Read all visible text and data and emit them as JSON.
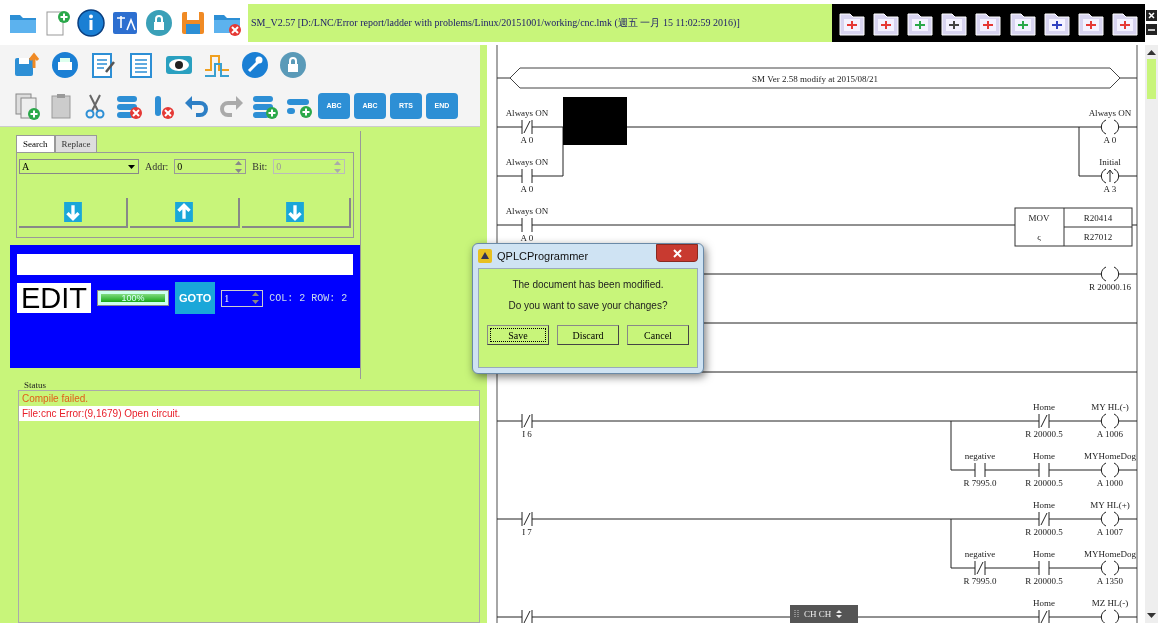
{
  "title": "SM_V2.57 [D:/LNC/Error report/ladder with problems/Linux/20151001/working/cnc.lmk (週五 一月 15 11:02:59 2016)]",
  "insert_buttons": [
    {
      "label": "ABC"
    },
    {
      "label": "ABC"
    },
    {
      "label": "RTS"
    },
    {
      "label": "END"
    }
  ],
  "search": {
    "tabs": [
      {
        "label": "Search",
        "selected": true
      },
      {
        "label": "Replace",
        "selected": false
      }
    ],
    "device": "A",
    "addr_label": "Addr:",
    "addr": "0",
    "bit_label": "Bit:",
    "bit": "0",
    "bit_disabled": true
  },
  "edit_panel": {
    "mode": "EDIT",
    "progress": {
      "level": 1,
      "text": "100%"
    },
    "goto": "GOTO",
    "spin": "1",
    "position": "COL: 2 ROW: 2"
  },
  "status": {
    "label": "Status",
    "messages": [
      {
        "text": "Compile failed.",
        "color": "#e0601a",
        "selected": false
      },
      {
        "text": "File:cnc Error:(9,1679) Open circuit.",
        "color": "#e8202a",
        "selected": true
      }
    ]
  },
  "ladder": {
    "rows": [
      {
        "kind": "comment",
        "text": "SM Ver 2.58 modify at 2015/08/21"
      },
      {
        "kind": "rung",
        "left": [
          {
            "kind": "nc",
            "name": "Always ON",
            "address": "A 0"
          },
          {
            "kind": "redacted"
          }
        ],
        "right": [
          {
            "kind": "coil",
            "name": "Always ON",
            "address": "A 0"
          }
        ],
        "branches": [
          {
            "kind": "left_branch",
            "elements": [
              {
                "kind": "no",
                "name": "Always ON",
                "address": "A 0"
              }
            ]
          },
          {
            "kind": "right_branch",
            "elements": [
              {
                "kind": "pulse_coil",
                "name": "Initial",
                "address": "A 3"
              }
            ]
          }
        ]
      },
      {
        "kind": "rung",
        "left": [
          {
            "kind": "no",
            "name": "Always ON",
            "address": "A 0"
          }
        ],
        "right": [
          {
            "kind": "mov",
            "op": "MOV",
            "symbol": "ς",
            "source": "R20414",
            "dest": "R27012"
          }
        ]
      },
      {
        "kind": "rung",
        "right": [
          {
            "kind": "coil",
            "address": "R 20000.16"
          }
        ]
      },
      {
        "kind": "rung"
      },
      {
        "kind": "rung"
      },
      {
        "kind": "rung",
        "left": [
          {
            "kind": "nc",
            "address": "I 6"
          }
        ],
        "right": [
          {
            "kind": "nc",
            "name": "Home",
            "address": "R 20000.5"
          },
          {
            "kind": "coil",
            "name": "MY HL(-)",
            "address": "A 1006"
          }
        ],
        "branches": [
          {
            "kind": "right_branch",
            "elements": [
              {
                "kind": "no",
                "name": "negative",
                "address": "R 7995.0"
              },
              {
                "kind": "no",
                "name": "Home",
                "address": "R 20000.5"
              },
              {
                "kind": "coil",
                "name": "MYHomeDog",
                "address": "A 1000"
              }
            ]
          }
        ]
      },
      {
        "kind": "rung",
        "left": [
          {
            "kind": "nc",
            "address": "I 7"
          }
        ],
        "right": [
          {
            "kind": "nc",
            "name": "Home",
            "address": "R 20000.5"
          },
          {
            "kind": "coil",
            "name": "MY HL(+)",
            "address": "A 1007"
          }
        ],
        "branches": [
          {
            "kind": "right_branch",
            "elements": [
              {
                "kind": "nc",
                "name": "negative",
                "address": "R 7995.0"
              },
              {
                "kind": "no",
                "name": "Home",
                "address": "R 20000.5"
              },
              {
                "kind": "coil",
                "name": "MYHomeDog",
                "address": "A 1350"
              }
            ]
          }
        ]
      },
      {
        "kind": "rung",
        "left": [
          {
            "kind": "nc"
          }
        ],
        "right": [
          {
            "kind": "nc",
            "name": "Home"
          },
          {
            "kind": "coil",
            "name": "MZ HL(-)"
          }
        ]
      }
    ]
  },
  "dialog": {
    "title": "QPLCProgrammer",
    "lines": [
      "The document has been modified.",
      "Do you want to save your changes?"
    ],
    "buttons": [
      {
        "label": "Save",
        "focused": true
      },
      {
        "label": "Discard",
        "focused": false
      },
      {
        "label": "Cancel",
        "focused": false
      }
    ]
  },
  "ime_bar": {
    "text": "CH CH"
  }
}
